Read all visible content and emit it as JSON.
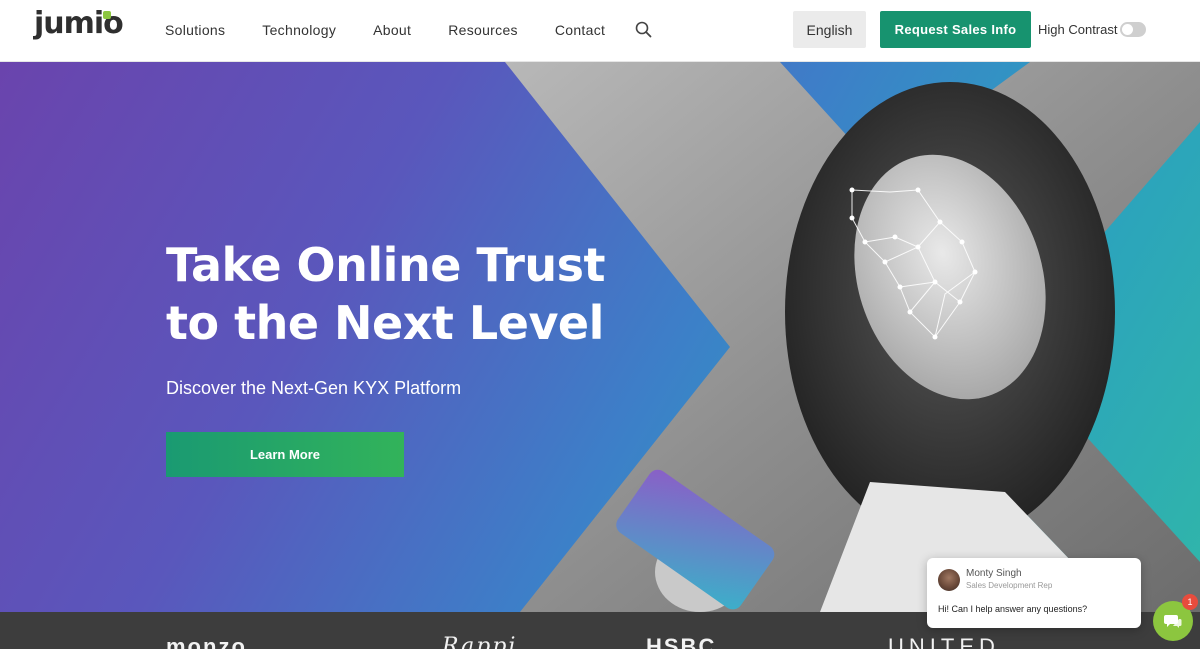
{
  "header": {
    "logo_text": "jumio",
    "nav": [
      {
        "label": "Solutions"
      },
      {
        "label": "Technology"
      },
      {
        "label": "About"
      },
      {
        "label": "Resources"
      },
      {
        "label": "Contact"
      }
    ],
    "search_icon": "search-icon",
    "language_label": "English",
    "cta_label": "Request Sales Info",
    "high_contrast_label": "High Contrast",
    "high_contrast_on": false
  },
  "hero": {
    "title_line1": "Take Online Trust",
    "title_line2": "to the Next Level",
    "subtitle": "Discover the Next-Gen KYX Platform",
    "button_label": "Learn More"
  },
  "clients": [
    {
      "name": "monzo"
    },
    {
      "name": "Rappi"
    },
    {
      "name": "HSBC"
    },
    {
      "name": "UNITED"
    }
  ],
  "chat": {
    "agent_name": "Monty Singh",
    "agent_role": "Sales Development Rep",
    "message": "Hi! Can I help answer any questions?",
    "unread_count": "1"
  },
  "colors": {
    "brand_green": "#17936f",
    "accent_green": "#8cc63f",
    "hero_purple": "#6a44ad",
    "hero_teal": "#30b6a9"
  }
}
